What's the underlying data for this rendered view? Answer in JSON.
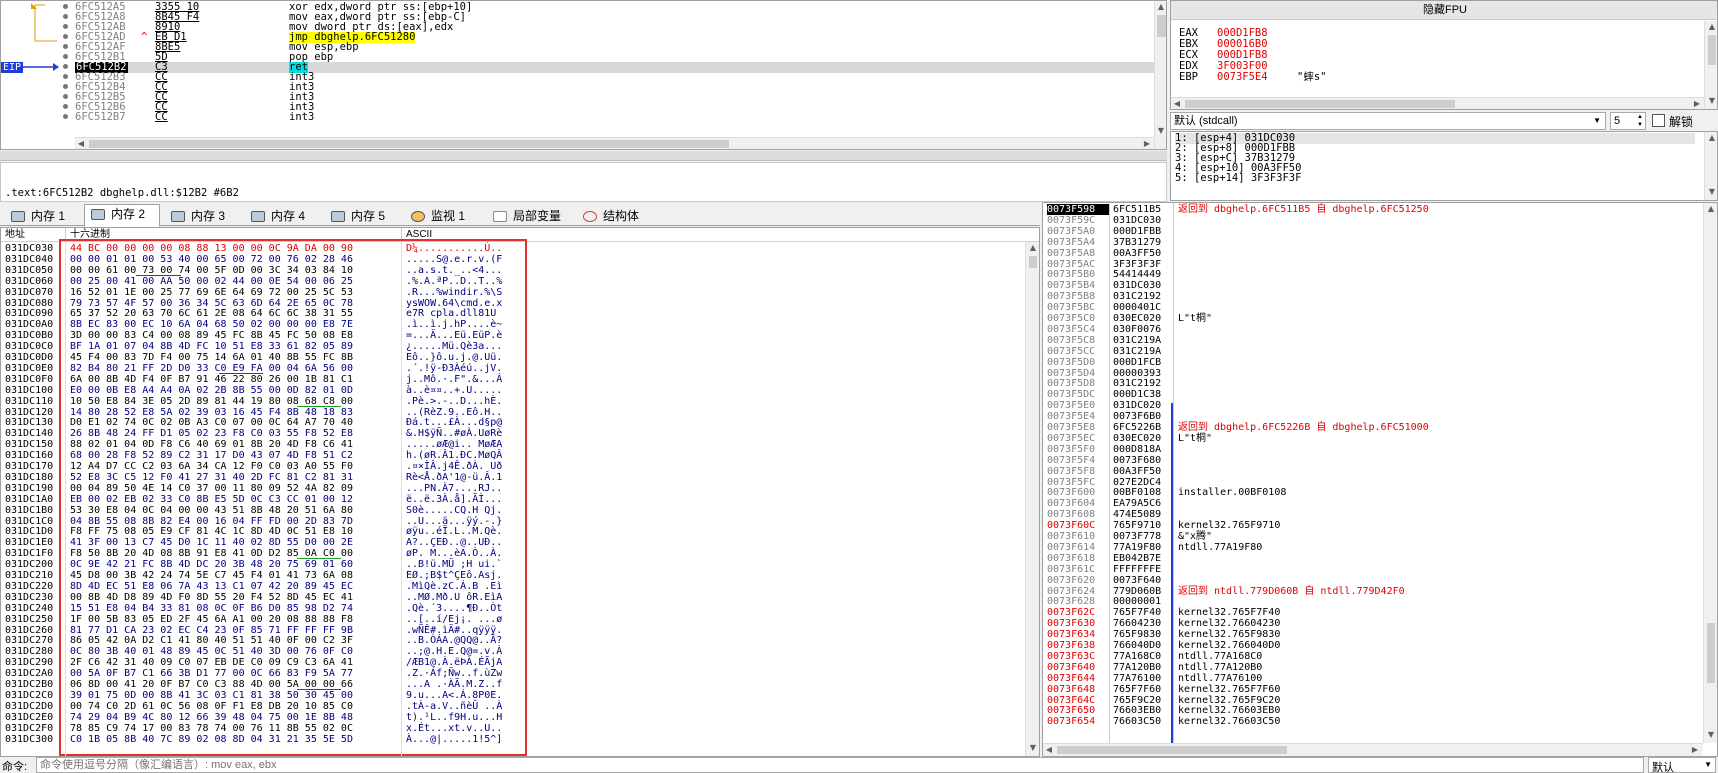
{
  "disasm": {
    "eip_label": "EIP",
    "rows": [
      {
        "addr": "6FC512A5",
        "bytes": "3355 10",
        "ins": "xor edx,dword ptr ss:[ebp+10]",
        "sel": false,
        "mark": ""
      },
      {
        "addr": "6FC512A8",
        "bytes": "8B45 F4",
        "ins": "mov eax,dword ptr ss:[ebp-C]",
        "sel": false,
        "mark": ""
      },
      {
        "addr": "6FC512AB",
        "bytes": "8910",
        "ins": "mov dword ptr ds:[eax],edx",
        "sel": false,
        "mark": ""
      },
      {
        "addr": "6FC512AD",
        "bytes": "EB D1",
        "ins": "jmp dbghelp.6FC51280",
        "sel": false,
        "mark": "^"
      },
      {
        "addr": "6FC512AF",
        "bytes": "8BE5",
        "ins": "mov esp,ebp",
        "sel": false,
        "mark": ""
      },
      {
        "addr": "6FC512B1",
        "bytes": "5D",
        "ins": "pop ebp",
        "sel": false,
        "mark": ""
      },
      {
        "addr": "6FC512B2",
        "bytes": "C3",
        "ins": "ret",
        "sel": true,
        "mark": ""
      },
      {
        "addr": "6FC512B3",
        "bytes": "CC",
        "ins": "int3",
        "sel": false,
        "mark": ""
      },
      {
        "addr": "6FC512B4",
        "bytes": "CC",
        "ins": "int3",
        "sel": false,
        "mark": ""
      },
      {
        "addr": "6FC512B5",
        "bytes": "CC",
        "ins": "int3",
        "sel": false,
        "mark": ""
      },
      {
        "addr": "6FC512B6",
        "bytes": "CC",
        "ins": "int3",
        "sel": false,
        "mark": ""
      },
      {
        "addr": "6FC512B7",
        "bytes": "CC",
        "ins": "int3",
        "sel": false,
        "mark": ""
      }
    ]
  },
  "info_line": ".text:6FC512B2 dbghelp.dll:$12B2 #6B2",
  "registers": {
    "title": "隐藏FPU",
    "rows": [
      {
        "name": "EAX",
        "value": "000D1FB8",
        "comment": ""
      },
      {
        "name": "EBX",
        "value": "000016B0",
        "comment": ""
      },
      {
        "name": "ECX",
        "value": "000D1FB8",
        "comment": ""
      },
      {
        "name": "EDX",
        "value": "3F003F00",
        "comment": ""
      },
      {
        "name": "EBP",
        "value": "0073F5E4",
        "comment": "\"蟀s\""
      }
    ]
  },
  "callconv": {
    "selected": "默认 (stdcall)",
    "count": "5",
    "unlock_label": "解锁"
  },
  "args": [
    "1: [esp+4] 031DC030",
    "2: [esp+8] 000D1FBB",
    "3: [esp+C] 37B31279",
    "4: [esp+10] 00A3FF50",
    "5: [esp+14] 3F3F3F3F"
  ],
  "tabs": [
    {
      "label": "内存 1",
      "active": false,
      "icon": "memory-icon"
    },
    {
      "label": "内存 2",
      "active": true,
      "icon": "memory-icon"
    },
    {
      "label": "内存 3",
      "active": false,
      "icon": "memory-icon"
    },
    {
      "label": "内存 4",
      "active": false,
      "icon": "memory-icon"
    },
    {
      "label": "内存 5",
      "active": false,
      "icon": "memory-icon"
    },
    {
      "label": "监视 1",
      "active": false,
      "icon": "watch-icon"
    },
    {
      "label": "局部变量",
      "active": false,
      "icon": "locals-icon"
    },
    {
      "label": "结构体",
      "active": false,
      "icon": "struct-icon"
    }
  ],
  "dump": {
    "col_addr": "地址",
    "col_hex": "十六进制",
    "col_ascii": "ASCII",
    "rows": [
      {
        "addr": "031DC030",
        "hex": "44 BC 00 00 00 00 08 88 13 00 00 0C 9A DA 00 90",
        "ascii": "D¼...........Ú.."
      },
      {
        "addr": "031DC040",
        "hex": "00 00 01 01 00 53 40 00 65 00 72 00 76 02 28 46",
        "ascii": ".....S@.e.r.v.(F"
      },
      {
        "addr": "031DC050",
        "hex": "00 00 61 00 73 00 74 00 5F 0D 00 3C 34 03 84 10",
        "ascii": "..a.s.t._..<4..."
      },
      {
        "addr": "031DC060",
        "hex": "00 25 00 41 00 AA 50 00 02 44 00 0E 54 00 06 25",
        "ascii": ".%.A.ªP..D..T..%"
      },
      {
        "addr": "031DC070",
        "hex": "16 52 01 1E 00 25 77 69 6E 64 69 72 00 25 5C 53",
        "ascii": ".R...%windir.%\\S"
      },
      {
        "addr": "031DC080",
        "hex": "79 73 57 4F 57 00 36 34 5C 63 6D 64 2E 65 0C 78",
        "ascii": "ysWOW.64\\cmd.e.x"
      },
      {
        "addr": "031DC090",
        "hex": "65 37 52 20 63 70 6C 61 2E 08 64 6C 6C 38 31 55",
        "ascii": "e7R cpla.dll81U"
      },
      {
        "addr": "031DC0A0",
        "hex": "8B EC 83 00 EC 10 6A 04 68 50 02 00 00 00 E8 7E",
        "ascii": ".ì..ì.j.hP....è~"
      },
      {
        "addr": "031DC0B0",
        "hex": "3D 00 00 83 C4 00 08 89 45 FC 8B 45 FC 50 08 E8",
        "ascii": "=...Ä...Eü.EüP.è"
      },
      {
        "addr": "031DC0C0",
        "hex": "BF 1A 01 07 04 8B 4D FC 10 51 E8 33 61 82 05 89",
        "ascii": "¿.....Mü.Qè3a..."
      },
      {
        "addr": "031DC0D0",
        "hex": "45 F4 00 83 7D F4 00 75 14 6A 01 40 8B 55 FC 8B",
        "ascii": "Eô..}ô.u.j.@.Uü."
      },
      {
        "addr": "031DC0E0",
        "hex": "82 B4 80 21 FF 2D D0 33 C0 E9 FA 00 04 6A 56 00",
        "ascii": ".´.!ÿ-Ð3Àéú..jV."
      },
      {
        "addr": "031DC0F0",
        "hex": "6A 00 8B 4D F4 0F B7 91 46 22 80 26 00 1B 81 C1",
        "ascii": "j..Mô.·.F\".&...Á"
      },
      {
        "addr": "031DC100",
        "hex": "E0 00 0B E8 A4 A4 0A 02 2B 8B 55 00 0D 82 01 0D",
        "ascii": "à..è¤¤..+.U....."
      },
      {
        "addr": "031DC110",
        "hex": "10 50 E8 84 3E 05 2D 89 81 44 19 80 08 68 C8 00",
        "ascii": ".Pè.>.-..D...hÈ."
      },
      {
        "addr": "031DC120",
        "hex": "14 80 28 52 E8 5A 02 39 03 16 45 F4 8B 48 18 83",
        "ascii": "..(RèZ.9..Eô.H.."
      },
      {
        "addr": "031DC130",
        "hex": "D0 E1 02 74 0C 02 0B A3 C0 07 00 0C 64 A7 70 40",
        "ascii": "Ðá.t...£À...d§p@"
      },
      {
        "addr": "031DC140",
        "hex": "26 8B 48 24 FF D1 05 02 23 F8 C0 03 55 F8 52 E8",
        "ascii": "&.H$ÿÑ..#øÀ.UøRè"
      },
      {
        "addr": "031DC150",
        "hex": "88 02 01 04 0D F8 C6 40 69 01 8B 20 4D F8 C6 41",
        "ascii": ".....øÆ@i.. MøÆA"
      },
      {
        "addr": "031DC160",
        "hex": "68 00 28 F8 52 89 C2 31 17 D0 43 07 4D F8 51 C2",
        "ascii": "h.(øR.Â1.ÐC.MøQÂ"
      },
      {
        "addr": "031DC170",
        "hex": "12 A4 D7 CC C2 03 6A 34 CA 12 F0 C0 03 A0 55 F0",
        "ascii": ".¤×ÌÂ.j4Ê.ðÀ. Uð"
      },
      {
        "addr": "031DC180",
        "hex": "52 E8 3C C5 12 F0 41 27 31 40 2D FC 81 C2 81 31",
        "ascii": "Rè<Å.ðA'1@-ü.Â.1"
      },
      {
        "addr": "031DC190",
        "hex": "00 04 89 50 4E 14 C0 37 00 11 80 09 52 4A 82 09",
        "ascii": "...PN.À7....RJ.."
      },
      {
        "addr": "031DC1A0",
        "hex": "EB 00 02 EB 02 33 C0 8B E5 5D 0C C3 CC 01 00 12",
        "ascii": "ë..ë.3À.å].ÃÌ..."
      },
      {
        "addr": "031DC1B0",
        "hex": "53 30 E8 04 0C 04 00 00 43 51 8B 48 20 51 6A 80",
        "ascii": "S0è.....CQ.H Qj."
      },
      {
        "addr": "031DC1C0",
        "hex": "04 8B 55 08 8B 82 E4 00 16 04 FF FD 00 2D 83 7D",
        "ascii": "..U...ä...ÿý.-.}"
      },
      {
        "addr": "031DC1D0",
        "hex": "F8 FF 75 08 05 E9 CF 81 4C 1C 8D 4D 0C 51 E8 10",
        "ascii": "øÿu..éÏ.L..M.Qè."
      },
      {
        "addr": "031DC1E0",
        "hex": "41 3F 00 13 C7 45 D0 1C 11 40 02 8D 55 D0 00 2E",
        "ascii": "A?..ÇEÐ..@..UÐ.."
      },
      {
        "addr": "031DC1F0",
        "hex": "F8 50 8B 20 4D 08 8B 91 E8 41 0D D2 85 0A C0 00",
        "ascii": "øP. M...èA.Ò..À."
      },
      {
        "addr": "031DC200",
        "hex": "0C 9E 42 21 FC 8B 4D DC 20 3B 48 20 75 69 01 60",
        "ascii": "..B!ü.MÜ ;H ui.`"
      },
      {
        "addr": "031DC210",
        "hex": "45 D8 00 3B 42 24 74 5E C7 45 F4 01 41 73 6A 08",
        "ascii": "EØ.;B$t^ÇEô.Asj."
      },
      {
        "addr": "031DC220",
        "hex": "8D 4D EC 51 E8 06 7A 43 13 C1 07 42 20 89 45 EC",
        "ascii": ".MìQè.zC.Á.B .Eì"
      },
      {
        "addr": "031DC230",
        "hex": "00 8B 4D D8 89 4D F0 8D 55 20 F4 52 8D 45 EC 41",
        "ascii": "..MØ.Mð.U ôR.EìA"
      },
      {
        "addr": "031DC240",
        "hex": "15 51 E8 04 B4 33 81 08 0C 0F B6 D0 85 98 D2 74",
        "ascii": ".Qè.´3....¶Ð..Òt"
      },
      {
        "addr": "031DC250",
        "hex": "1F 00 5B 83 05 ED 2F 45 6A A1 00 20 08 88 88 F8",
        "ascii": "..[..í/Ej¡. ...ø"
      },
      {
        "addr": "031DC260",
        "hex": "81 77 D1 CA 23 02 EC C4 23 0F 85 71 FF FF FF 9B",
        "ascii": ".wÑÊ#.ìÄ#..qÿÿÿ."
      },
      {
        "addr": "031DC270",
        "hex": "86 05 42 0A D2 C1 41 80 40 51 51 40 0F 00 C2 3F",
        "ascii": "..B.ÒÁA.@QQ@..Â?"
      },
      {
        "addr": "031DC280",
        "hex": "0C 80 3B 40 01 48 89 45 0C 51 40 3D 00 76 0F C0",
        "ascii": "..;@.H.E.Q@=.v.À"
      },
      {
        "addr": "031DC290",
        "hex": "2F C6 42 31 40 09 C0 07 EB DE C0 09 C9 C3 6A 41",
        "ascii": "/ÆB1@.À.ëÞÀ.ÉÃjA"
      },
      {
        "addr": "031DC2A0",
        "hex": "00 5A 0F B7 C1 66 3B D1 77 00 0C 66 83 F9 5A 77",
        "ascii": ".Z.·Áf;Ñw..f.ùZw"
      },
      {
        "addr": "031DC2B0",
        "hex": "06 8D 00 41 20 0F B7 C0 C3 88 4D 00 5A 00 00 66",
        "ascii": "...A .·ÀÃ.M.Z..f"
      },
      {
        "addr": "031DC2C0",
        "hex": "39 01 75 0D 00 8B 41 3C 03 C1 81 38 50 30 45 00",
        "ascii": "9.u...A<.Á.8P0E."
      },
      {
        "addr": "031DC2D0",
        "hex": "00 74 C0 2D 61 0C 56 08 0F F1 E8 DB 20 10 85 C0",
        "ascii": ".tÀ-a.V..ñèÛ ..À"
      },
      {
        "addr": "031DC2E0",
        "hex": "74 29 04 B9 4C 80 12 66 39 48 04 75 00 1E 8B 48",
        "ascii": "t).¹L..f9H.u...H"
      },
      {
        "addr": "031DC2F0",
        "hex": "78 85 C9 74 17 00 83 78 74 00 76 11 8B 55 02 0C",
        "ascii": "x.Ét...xt.v..U.."
      },
      {
        "addr": "031DC300",
        "hex": "C0 1B 05 8B 40 7C 89 02 08 8D 04 31 21 35 5E 5D",
        "ascii": "À...@|.....1!5^]"
      }
    ]
  },
  "stack": {
    "rows": [
      {
        "addr": "0073F598",
        "val": "6FC511B5",
        "comment": "返回到 dbghelp.6FC511B5 自 dbghelp.6FC51250",
        "kind": "ret",
        "sel": true
      },
      {
        "addr": "0073F59C",
        "val": "031DC030",
        "comment": "",
        "kind": "",
        "sel": false
      },
      {
        "addr": "0073F5A0",
        "val": "000D1FBB",
        "comment": "",
        "kind": "",
        "sel": false
      },
      {
        "addr": "0073F5A4",
        "val": "37B31279",
        "comment": "",
        "kind": "",
        "sel": false
      },
      {
        "addr": "0073F5A8",
        "val": "00A3FF50",
        "comment": "",
        "kind": "",
        "sel": false
      },
      {
        "addr": "0073F5AC",
        "val": "3F3F3F3F",
        "comment": "",
        "kind": "",
        "sel": false
      },
      {
        "addr": "0073F5B0",
        "val": "54414449",
        "comment": "",
        "kind": "",
        "sel": false
      },
      {
        "addr": "0073F5B4",
        "val": "031DC030",
        "comment": "",
        "kind": "",
        "sel": false
      },
      {
        "addr": "0073F5B8",
        "val": "031C2192",
        "comment": "",
        "kind": "",
        "sel": false
      },
      {
        "addr": "0073F5BC",
        "val": "0000401C",
        "comment": "",
        "kind": "",
        "sel": false
      },
      {
        "addr": "0073F5C0",
        "val": "030EC020",
        "comment": "L\"t桐\"",
        "kind": "",
        "sel": false
      },
      {
        "addr": "0073F5C4",
        "val": "030F0076",
        "comment": "",
        "kind": "",
        "sel": false
      },
      {
        "addr": "0073F5C8",
        "val": "031C219A",
        "comment": "",
        "kind": "",
        "sel": false
      },
      {
        "addr": "0073F5CC",
        "val": "031C219A",
        "comment": "",
        "kind": "",
        "sel": false
      },
      {
        "addr": "0073F5D0",
        "val": "000D1FCB",
        "comment": "",
        "kind": "",
        "sel": false
      },
      {
        "addr": "0073F5D4",
        "val": "00000393",
        "comment": "",
        "kind": "",
        "sel": false
      },
      {
        "addr": "0073F5D8",
        "val": "031C2192",
        "comment": "",
        "kind": "",
        "sel": false
      },
      {
        "addr": "0073F5DC",
        "val": "000D1C38",
        "comment": "",
        "kind": "",
        "sel": false
      },
      {
        "addr": "0073F5E0",
        "val": "031DC020",
        "comment": "",
        "kind": "",
        "sel": false
      },
      {
        "addr": "0073F5E4",
        "val": "0073F6B0",
        "comment": "",
        "kind": "",
        "sel": false
      },
      {
        "addr": "0073F5E8",
        "val": "6FC5226B",
        "comment": "返回到 dbghelp.6FC5226B 自 dbghelp.6FC51000",
        "kind": "ret",
        "sel": false
      },
      {
        "addr": "0073F5EC",
        "val": "030EC020",
        "comment": "L\"t桐\"",
        "kind": "",
        "sel": false
      },
      {
        "addr": "0073F5F0",
        "val": "000D818A",
        "comment": "",
        "kind": "",
        "sel": false
      },
      {
        "addr": "0073F5F4",
        "val": "0073F680",
        "comment": "",
        "kind": "",
        "sel": false
      },
      {
        "addr": "0073F5F8",
        "val": "00A3FF50",
        "comment": "",
        "kind": "",
        "sel": false
      },
      {
        "addr": "0073F5FC",
        "val": "027E2DC4",
        "comment": "",
        "kind": "",
        "sel": false
      },
      {
        "addr": "0073F600",
        "val": "00BF0108",
        "comment": "installer.00BF0108",
        "kind": "",
        "sel": false
      },
      {
        "addr": "0073F604",
        "val": "EA79A5C6",
        "comment": "",
        "kind": "",
        "sel": false
      },
      {
        "addr": "0073F608",
        "val": "474E5089",
        "comment": "",
        "kind": "",
        "sel": false
      },
      {
        "addr": "0073F60C",
        "val": "765F9710",
        "comment": "kernel32.765F9710",
        "kind": "red",
        "sel": false
      },
      {
        "addr": "0073F610",
        "val": "0073F778",
        "comment": "&\"x腾\"",
        "kind": "",
        "sel": false
      },
      {
        "addr": "0073F614",
        "val": "77A19F80",
        "comment": "ntdll.77A19F80",
        "kind": "",
        "sel": false
      },
      {
        "addr": "0073F618",
        "val": "EB042B7E",
        "comment": "",
        "kind": "",
        "sel": false
      },
      {
        "addr": "0073F61C",
        "val": "FFFFFFFE",
        "comment": "",
        "kind": "",
        "sel": false
      },
      {
        "addr": "0073F620",
        "val": "0073F640",
        "comment": "",
        "kind": "",
        "sel": false
      },
      {
        "addr": "0073F624",
        "val": "779D060B",
        "comment": "返回到 ntdll.779D060B 自 ntdll.779D42F0",
        "kind": "ret",
        "sel": false
      },
      {
        "addr": "0073F628",
        "val": "00000001",
        "comment": "",
        "kind": "",
        "sel": false
      },
      {
        "addr": "0073F62C",
        "val": "765F7F40",
        "comment": "kernel32.765F7F40",
        "kind": "red",
        "sel": false
      },
      {
        "addr": "0073F630",
        "val": "76604230",
        "comment": "kernel32.76604230",
        "kind": "red",
        "sel": false
      },
      {
        "addr": "0073F634",
        "val": "765F9830",
        "comment": "kernel32.765F9830",
        "kind": "red",
        "sel": false
      },
      {
        "addr": "0073F638",
        "val": "766040D0",
        "comment": "kernel32.766040D0",
        "kind": "red",
        "sel": false
      },
      {
        "addr": "0073F63C",
        "val": "77A168C0",
        "comment": "ntdll.77A168C0",
        "kind": "red",
        "sel": false
      },
      {
        "addr": "0073F640",
        "val": "77A120B0",
        "comment": "ntdll.77A120B0",
        "kind": "red",
        "sel": false
      },
      {
        "addr": "0073F644",
        "val": "77A76100",
        "comment": "ntdll.77A76100",
        "kind": "red",
        "sel": false
      },
      {
        "addr": "0073F648",
        "val": "765F7F60",
        "comment": "kernel32.765F7F60",
        "kind": "red",
        "sel": false
      },
      {
        "addr": "0073F64C",
        "val": "765F9C20",
        "comment": "kernel32.765F9C20",
        "kind": "red",
        "sel": false
      },
      {
        "addr": "0073F650",
        "val": "76603EB0",
        "comment": "kernel32.76603EB0",
        "kind": "red",
        "sel": false
      },
      {
        "addr": "0073F654",
        "val": "76603C50",
        "comment": "kernel32.76603C50",
        "kind": "red",
        "sel": false
      }
    ]
  },
  "cmd": {
    "label": "命令:",
    "placeholder": "命令使用逗号分隔（像汇编语言）: mov eax, ebx",
    "mode": "默认"
  },
  "colors": {
    "accent_red": "#e00000",
    "selection_blue": "#000080",
    "highlight_box": "#e03030",
    "eip_blue": "#0000ff"
  }
}
